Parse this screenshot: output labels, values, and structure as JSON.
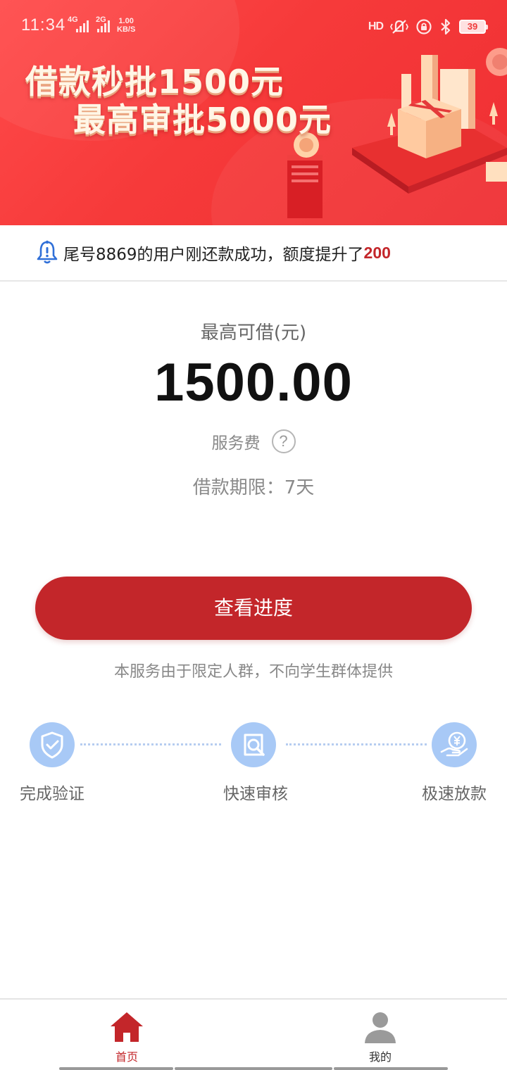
{
  "status_bar": {
    "time": "11:34",
    "network_1": "4G",
    "network_2": "2G",
    "speed_value": "1.00",
    "speed_unit": "KB/S",
    "hd_label": "HD",
    "battery": "39"
  },
  "banner": {
    "headline_line1": "借款秒批1500元",
    "headline_line2": "最高审批5000元"
  },
  "notice": {
    "text": "尾号8869的用户刚还款成功，额度提升了",
    "amount": "200"
  },
  "loan": {
    "max_label": "最高可借(元)",
    "max_amount": "1500.00",
    "fee_label": "服务费",
    "help_symbol": "?",
    "term_label": "借款期限：7天"
  },
  "actions": {
    "progress_button": "查看进度"
  },
  "disclaimer": "本服务由于限定人群，不向学生群体提供",
  "steps": [
    {
      "label": "完成验证",
      "icon": "shield-check-icon"
    },
    {
      "label": "快速审核",
      "icon": "search-document-icon"
    },
    {
      "label": "极速放款",
      "icon": "yen-hand-icon"
    }
  ],
  "bottom_nav": [
    {
      "label": "首页",
      "icon": "home-icon",
      "active": true
    },
    {
      "label": "我的",
      "icon": "user-icon",
      "active": false
    }
  ],
  "colors": {
    "brand_red": "#c3262a",
    "banner_red": "#f63a3a",
    "step_blue": "#a8c9f6",
    "inactive_gray": "#9a9a9a"
  }
}
